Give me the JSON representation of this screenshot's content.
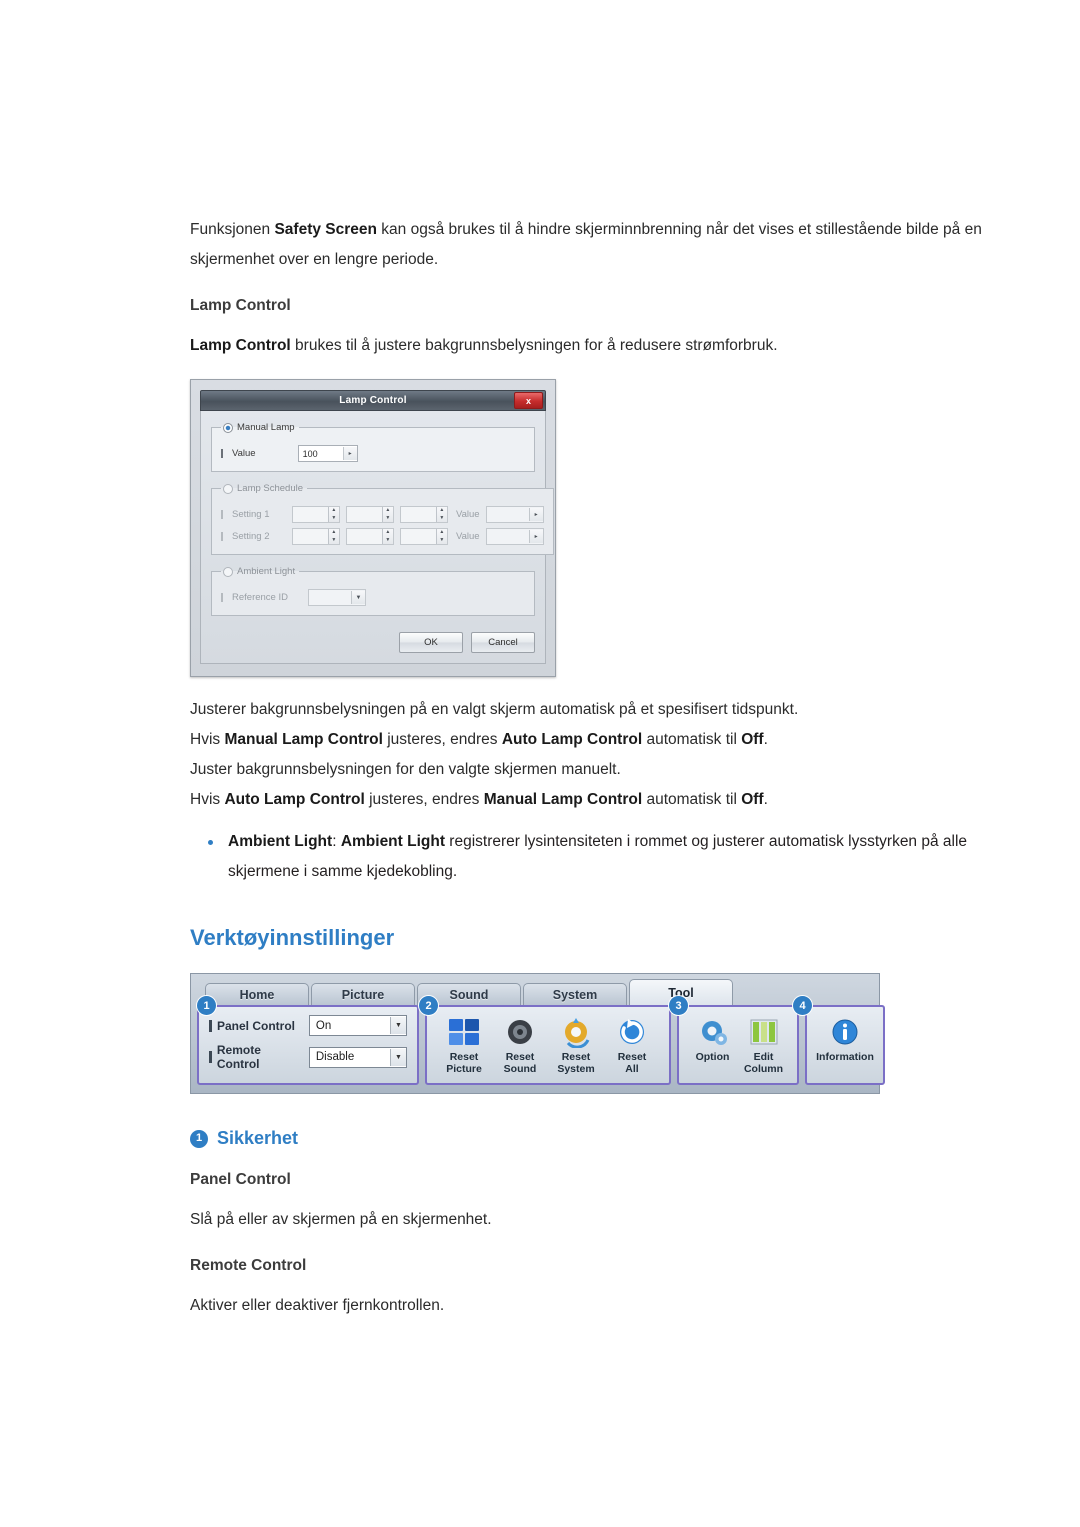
{
  "intro": {
    "line1_pre": "Funksjonen ",
    "line1_bold": "Safety Screen",
    "line1_post": " kan også brukes til å hindre skjerminnbrenning når det vises et stillestående bilde på en skjermenhet over en lengre periode."
  },
  "lamp_section": {
    "heading": "Lamp Control",
    "desc_bold": "Lamp Control",
    "desc_rest": " brukes til å justere bakgrunnsbelysningen for å redusere strømforbruk."
  },
  "lamp_dialog": {
    "title": "Lamp Control",
    "close_label": "x",
    "manual_lamp_legend": "Manual Lamp",
    "value_label": "Value",
    "value_field": "100",
    "lamp_schedule_legend": "Lamp Schedule",
    "setting1_label": "Setting 1",
    "setting2_label": "Setting 2",
    "schedule_value_label": "Value",
    "ambient_light_legend": "Ambient Light",
    "reference_id_label": "Reference ID",
    "ok_label": "OK",
    "cancel_label": "Cancel"
  },
  "lamp_notes": [
    {
      "segments": [
        {
          "text": "Justerer bakgrunnsbelysningen på en valgt skjerm automatisk på et spesifisert tidspunkt.",
          "bold": false
        }
      ]
    },
    {
      "segments": [
        {
          "text": "Hvis ",
          "bold": false
        },
        {
          "text": "Manual Lamp Control",
          "bold": true
        },
        {
          "text": " justeres, endres ",
          "bold": false
        },
        {
          "text": "Auto Lamp Control",
          "bold": true
        },
        {
          "text": " automatisk til ",
          "bold": false
        },
        {
          "text": "Off",
          "bold": true
        },
        {
          "text": ".",
          "bold": false
        }
      ]
    },
    {
      "segments": [
        {
          "text": "Juster bakgrunnsbelysningen for den valgte skjermen manuelt.",
          "bold": false
        }
      ]
    },
    {
      "segments": [
        {
          "text": "Hvis ",
          "bold": false
        },
        {
          "text": "Auto Lamp Control",
          "bold": true
        },
        {
          "text": " justeres, endres ",
          "bold": false
        },
        {
          "text": "Manual Lamp Control",
          "bold": true
        },
        {
          "text": " automatisk til ",
          "bold": false
        },
        {
          "text": "Off",
          "bold": true
        },
        {
          "text": ".",
          "bold": false
        }
      ]
    }
  ],
  "ambient_bullet": {
    "bold1": "Ambient Light",
    "mid": ": ",
    "bold2": "Ambient Light",
    "rest": " registrerer lysintensiteten i rommet og justerer automatisk lysstyrken på alle skjermene i samme kjedekobling."
  },
  "tools_section": {
    "title": "Verktøyinnstillinger"
  },
  "mdc_toolbar": {
    "tabs": [
      {
        "label": "Home",
        "active": false
      },
      {
        "label": "Picture",
        "active": false
      },
      {
        "label": "Sound",
        "active": false
      },
      {
        "label": "System",
        "active": false
      },
      {
        "label": "Tool",
        "active": true
      }
    ],
    "badges": [
      "1",
      "2",
      "3",
      "4"
    ],
    "panel1": {
      "rows": [
        {
          "label": "Panel Control",
          "value": "On"
        },
        {
          "label": "Remote Control",
          "value": "Disable"
        }
      ]
    },
    "panel2": {
      "items": [
        {
          "caption_line1": "Reset",
          "caption_line2": "Picture",
          "icon": "reset-picture-icon"
        },
        {
          "caption_line1": "Reset",
          "caption_line2": "Sound",
          "icon": "reset-sound-icon"
        },
        {
          "caption_line1": "Reset",
          "caption_line2": "System",
          "icon": "reset-system-icon"
        },
        {
          "caption_line1": "Reset",
          "caption_line2": "All",
          "icon": "reset-all-icon"
        }
      ]
    },
    "panel3": {
      "items": [
        {
          "caption_line1": "Option",
          "caption_line2": "",
          "icon": "option-gear-icon"
        },
        {
          "caption_line1": "Edit",
          "caption_line2": "Column",
          "icon": "edit-column-icon"
        }
      ]
    },
    "panel4": {
      "items": [
        {
          "caption_line1": "Information",
          "caption_line2": "",
          "icon": "information-icon"
        }
      ]
    }
  },
  "security": {
    "badge": "1",
    "title": "Sikkerhet",
    "panel_control_head": "Panel Control",
    "panel_control_text": "Slå på eller av skjermen på en skjermenhet.",
    "remote_control_head": "Remote Control",
    "remote_control_text": "Aktiver eller deaktiver fjernkontrollen."
  }
}
